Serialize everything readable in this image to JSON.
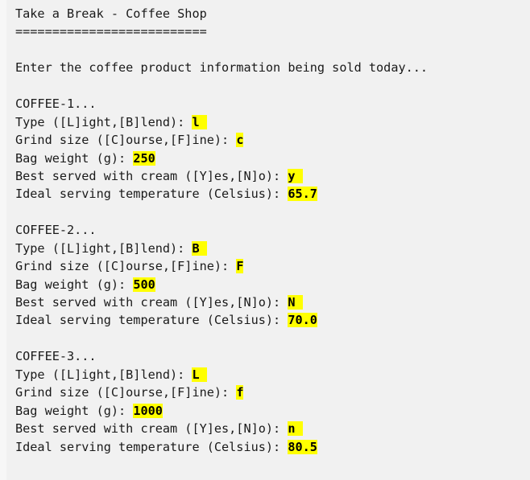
{
  "terminal": {
    "background_color": "#f1f1f1",
    "text_color": "#1a1a1a",
    "highlight_color": "#ffff00",
    "title": "Take a Break - Coffee Shop",
    "title_rule": "==========================",
    "prompt": "Enter the coffee product information being sold today...",
    "blank": " "
  },
  "labels": {
    "type": "Type ([L]ight,[B]lend): ",
    "grind": "Grind size ([C]ourse,[F]ine): ",
    "weight": "Bag weight (g): ",
    "cream": "Best served with cream ([Y]es,[N]o): ",
    "temperature": "Ideal serving temperature (Celsius): "
  },
  "entries": [
    {
      "heading": "COFFEE-1...",
      "type": "l",
      "grind": "c",
      "weight": "250",
      "cream": "y",
      "temperature": "65.7"
    },
    {
      "heading": "COFFEE-2...",
      "type": "B",
      "grind": "F",
      "weight": "500",
      "cream": "N",
      "temperature": "70.0"
    },
    {
      "heading": "COFFEE-3...",
      "type": "L",
      "grind": "f",
      "weight": "1000",
      "cream": "n",
      "temperature": "80.5"
    }
  ]
}
